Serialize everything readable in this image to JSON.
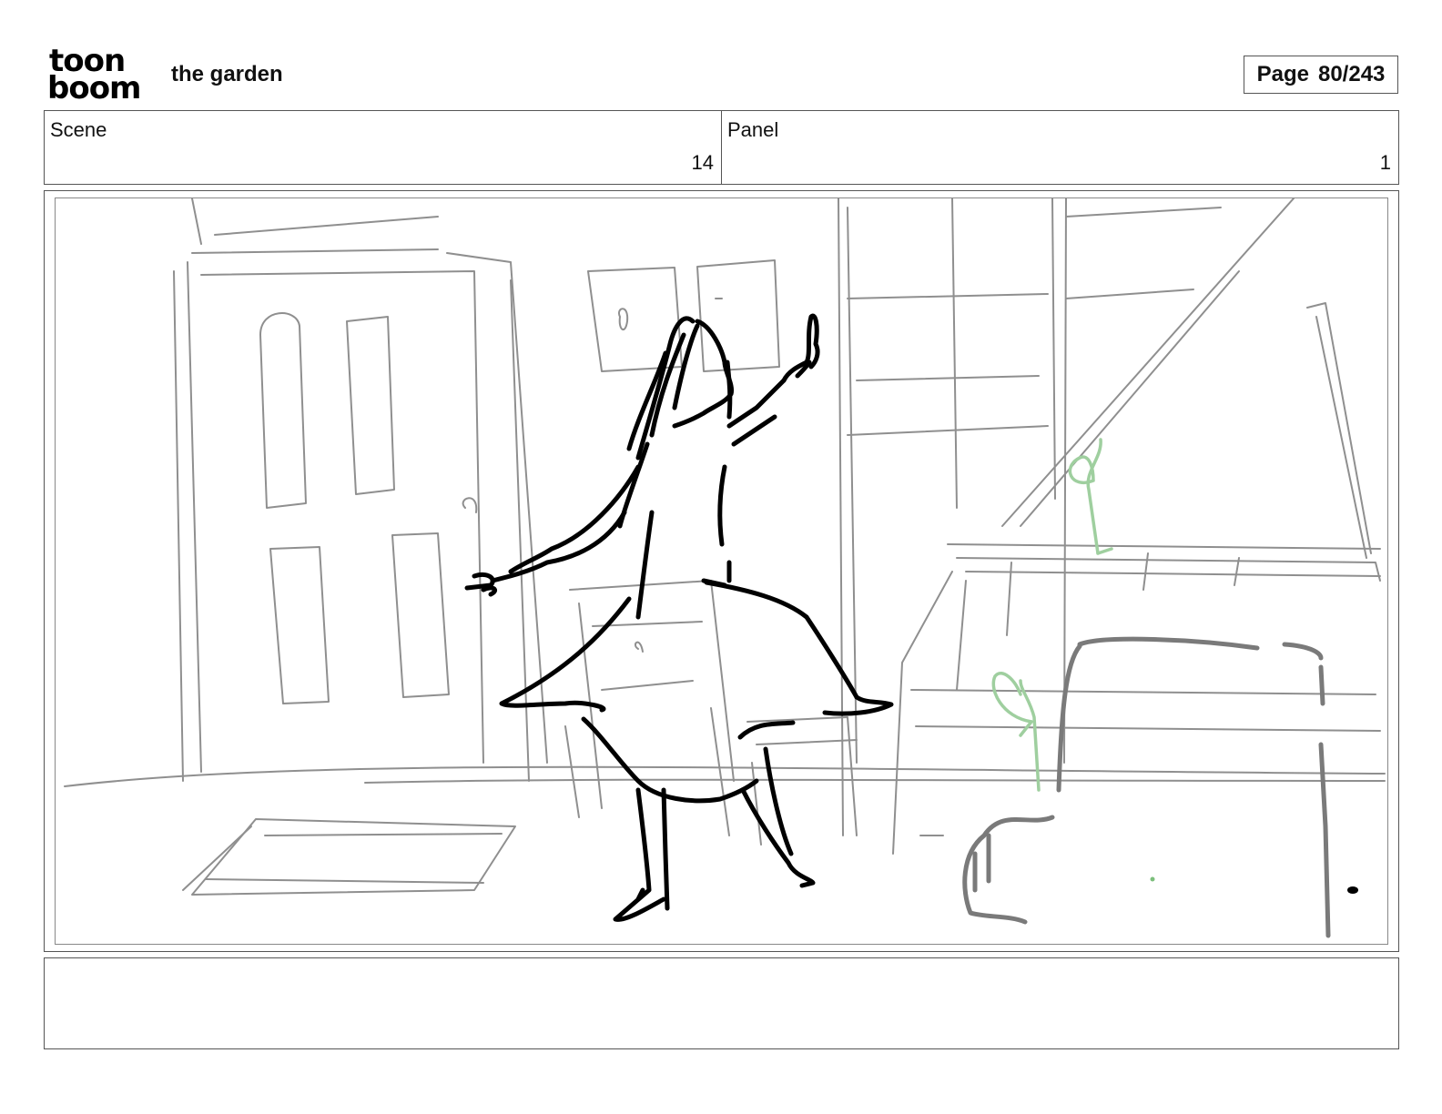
{
  "header": {
    "logo_text_top": "toon",
    "logo_text_bottom": "boom",
    "title": "the garden",
    "page_label": "Page",
    "page_value": "80/243"
  },
  "info": {
    "scene_label": "Scene",
    "scene_value": "14",
    "panel_label": "Panel",
    "panel_value": "1"
  },
  "notes": {
    "text": ""
  }
}
